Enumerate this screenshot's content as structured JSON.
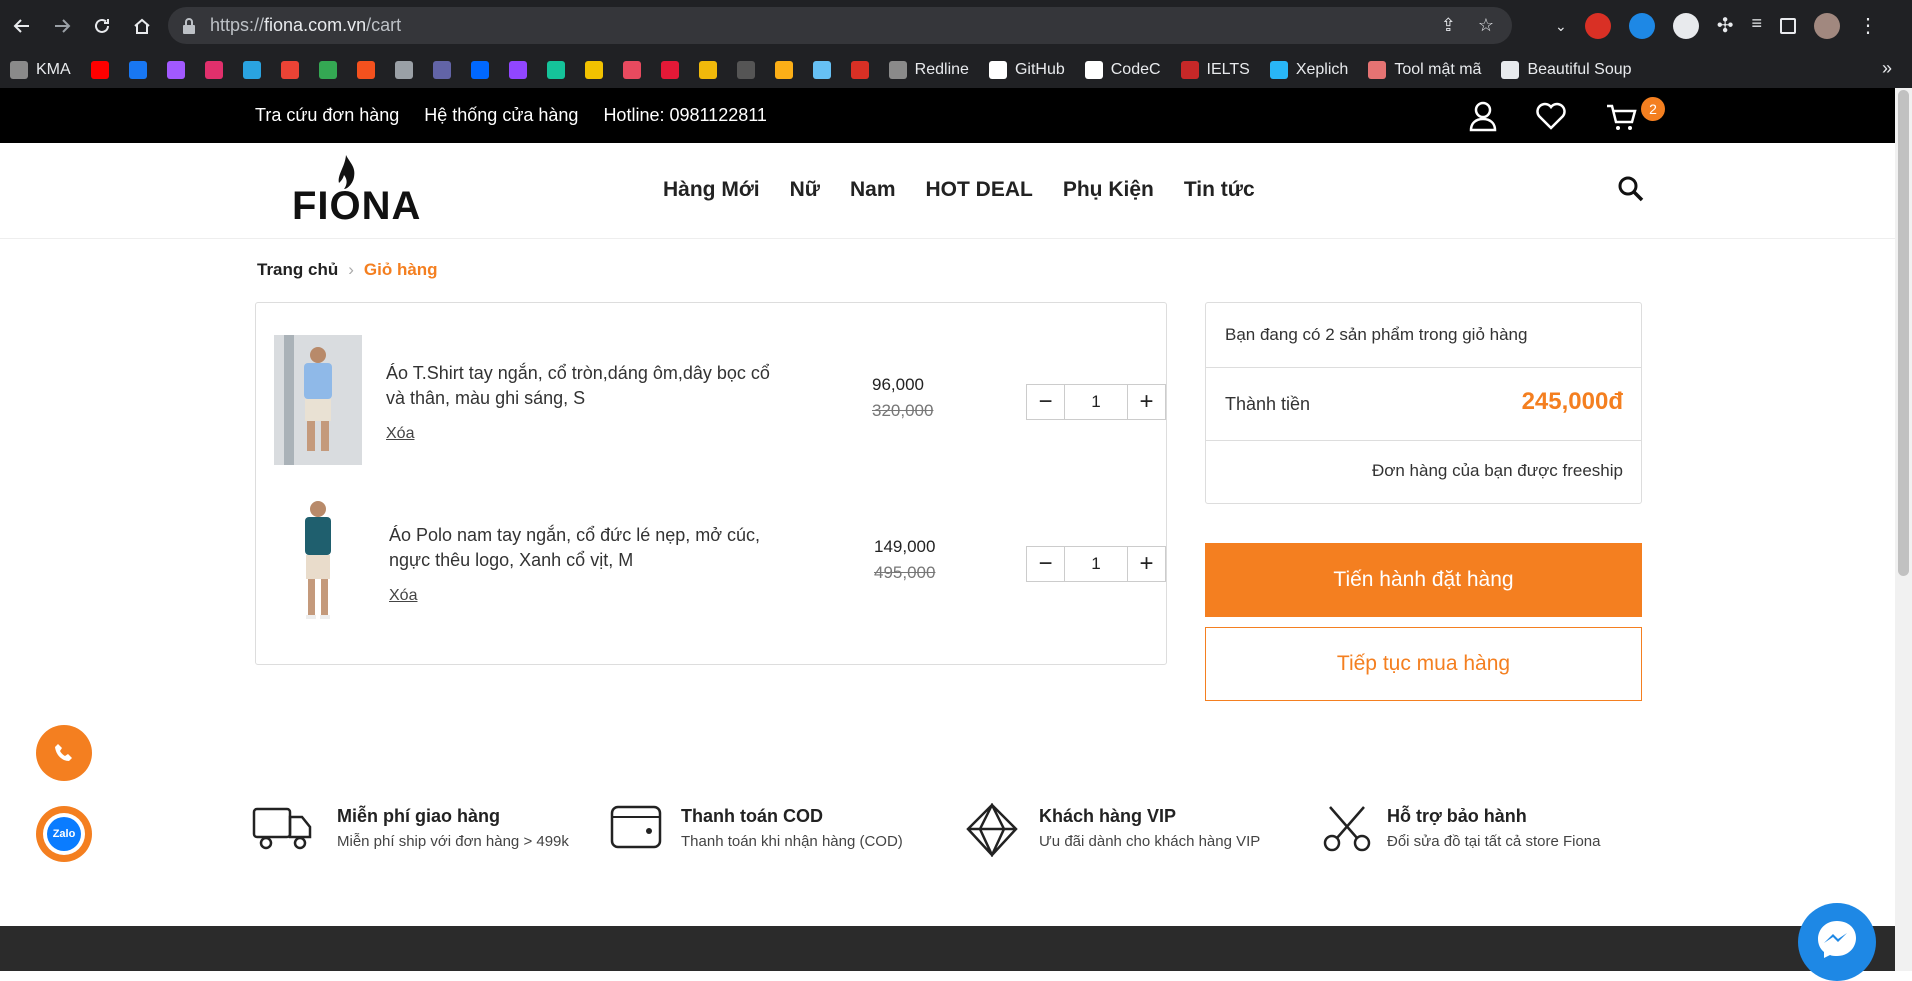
{
  "browser": {
    "url_scheme": "https://",
    "url_host": "fiona.com.vn",
    "url_path": "/cart",
    "bookmarks": [
      {
        "label": "KMA",
        "icon": "globe-icon",
        "color": "#8a8a8a"
      },
      {
        "label": "",
        "icon": "youtube-icon",
        "color": "#ff0000"
      },
      {
        "label": "",
        "icon": "facebook-icon",
        "color": "#1877f2"
      },
      {
        "label": "",
        "icon": "messenger-icon",
        "color": "#a259ff"
      },
      {
        "label": "",
        "icon": "instagram-icon",
        "color": "#e1306c"
      },
      {
        "label": "",
        "icon": "telegram-icon",
        "color": "#2aa3e0"
      },
      {
        "label": "",
        "icon": "gmail-icon",
        "color": "#ea4335"
      },
      {
        "label": "",
        "icon": "drive-icon",
        "color": "#34a853"
      },
      {
        "label": "",
        "icon": "slides-icon",
        "color": "#f4511e"
      },
      {
        "label": "",
        "icon": "chat-icon",
        "color": "#9aa0a6"
      },
      {
        "label": "",
        "icon": "teams-icon",
        "color": "#6264a7"
      },
      {
        "label": "",
        "icon": "zalo-icon",
        "color": "#0068ff"
      },
      {
        "label": "",
        "icon": "twitch-icon",
        "color": "#9146ff"
      },
      {
        "label": "",
        "icon": "grammarly-icon",
        "color": "#15c39a"
      },
      {
        "label": "",
        "icon": "tg-icon",
        "color": "#f2c200"
      },
      {
        "label": "",
        "icon": "target-icon",
        "color": "#e84a5f"
      },
      {
        "label": "",
        "icon": "tesla-icon",
        "color": "#e31937"
      },
      {
        "label": "",
        "icon": "binance-icon",
        "color": "#f0b90b"
      },
      {
        "label": "",
        "icon": "epic-icon",
        "color": "#555555"
      },
      {
        "label": "",
        "icon": "rockstar-icon",
        "color": "#fcaf17"
      },
      {
        "label": "",
        "icon": "steam-icon",
        "color": "#66c0f4"
      },
      {
        "label": "",
        "icon": "redline-logo-icon",
        "color": "#d93025"
      },
      {
        "label": "Redline",
        "icon": "globe-icon",
        "color": "#8a8a8a"
      },
      {
        "label": "GitHub",
        "icon": "github-icon",
        "color": "#ffffff"
      },
      {
        "label": "CodeC",
        "icon": "github-icon",
        "color": "#ffffff"
      },
      {
        "label": "IELTS",
        "icon": "ielts-icon",
        "color": "#c62828"
      },
      {
        "label": "Xeplich",
        "icon": "xeplich-icon",
        "color": "#29b6f6"
      },
      {
        "label": "Tool mật mã",
        "icon": "calendar-icon",
        "color": "#e57373"
      },
      {
        "label": "Beautiful Soup",
        "icon": "soup-icon",
        "color": "#e8eaed"
      }
    ]
  },
  "topbar": {
    "links": [
      "Tra cứu đơn hàng",
      "Hệ thống cửa hàng",
      "Hotline: 0981122811"
    ],
    "cart_count": "2"
  },
  "header": {
    "logo": "FIONA",
    "menu": [
      "Hàng Mới",
      "Nữ",
      "Nam",
      "HOT DEAL",
      "Phụ Kiện",
      "Tin tức"
    ]
  },
  "breadcrumb": {
    "home": "Trang chủ",
    "current": "Giỏ hàng"
  },
  "cart": {
    "items": [
      {
        "name": "Áo T.Shirt tay ngắn, cổ tròn,dáng ôm,dây bọc cổ và thân, màu ghi sáng, S",
        "remove": "Xóa",
        "price": "96,000",
        "old_price": "320,000",
        "qty": "1",
        "shirt_color": "#8fb9e8"
      },
      {
        "name": "Áo Polo nam tay ngắn, cổ đức lé nẹp, mở cúc, ngực thêu logo, Xanh cổ vịt, M",
        "remove": "Xóa",
        "price": "149,000",
        "old_price": "495,000",
        "qty": "1",
        "shirt_color": "#1f5f6e"
      }
    ]
  },
  "summary": {
    "count_text": "Bạn đang có 2 sản phẩm trong giỏ hàng",
    "total_label": "Thành tiền",
    "total_value": "245,000đ",
    "freeship": "Đơn hàng của bạn được freeship",
    "order_button": "Tiến hành đặt hàng",
    "continue_button": "Tiếp tục mua hàng"
  },
  "features": [
    {
      "title": "Miễn phí giao hàng",
      "sub": "Miễn phí ship với đơn hàng > 499k",
      "icon": "truck-icon"
    },
    {
      "title": "Thanh toán COD",
      "sub": "Thanh toán khi nhận hàng (COD)",
      "icon": "wallet-icon"
    },
    {
      "title": "Khách hàng VIP",
      "sub": "Ưu đãi dành cho khách hàng VIP",
      "icon": "diamond-icon"
    },
    {
      "title": "Hỗ trợ bảo hành",
      "sub": "Đổi sửa đồ tại tất cả store Fiona",
      "icon": "scissors-icon"
    }
  ],
  "floating": {
    "zalo_label": "Zalo"
  },
  "colors": {
    "accent": "#f47f20",
    "topbar": "#000000",
    "footer": "#2b2b2b"
  }
}
